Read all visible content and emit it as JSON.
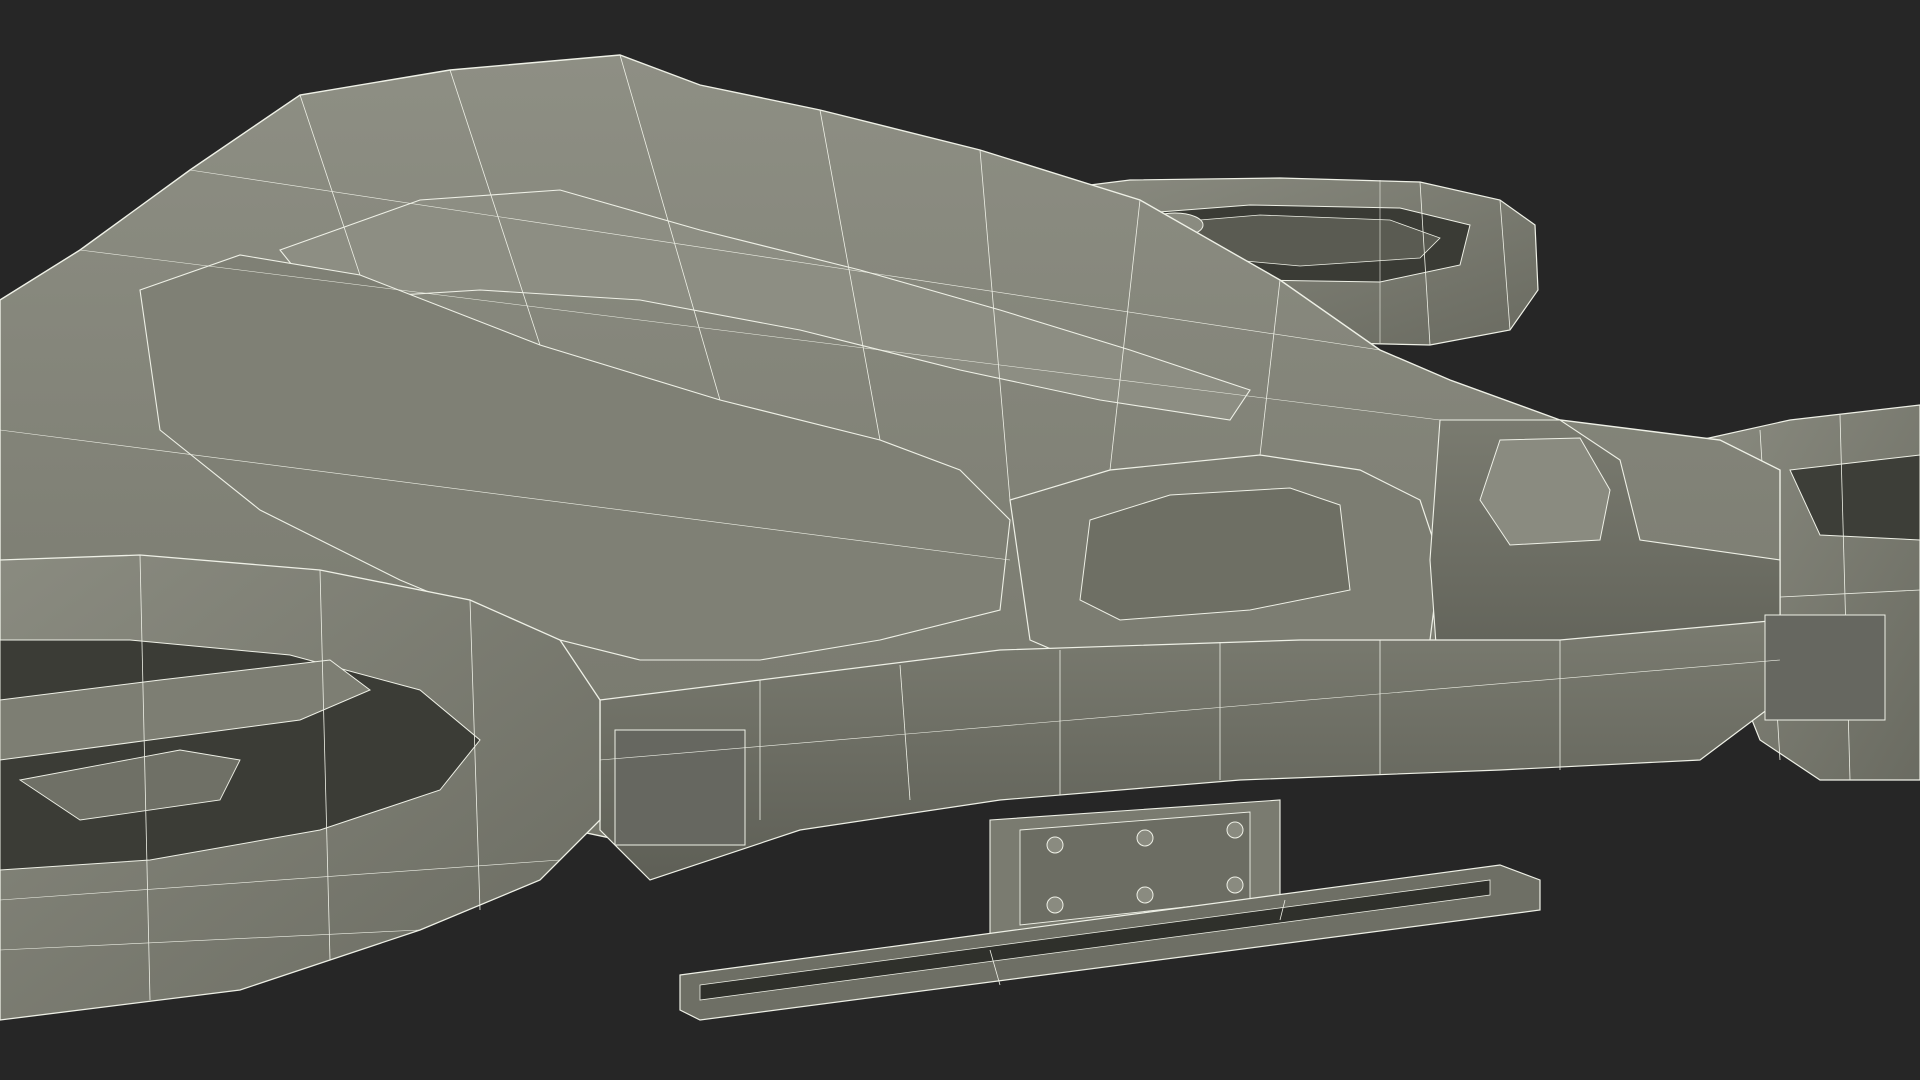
{
  "scene": {
    "subject": "",
    "colors": {
      "background": "#262626",
      "surface_light": "#8a8b80",
      "surface_mid": "#7b7c71",
      "surface_dark": "#5f6057",
      "surface_shadow": "#4c4d45",
      "wire": "#eef0e6"
    }
  }
}
